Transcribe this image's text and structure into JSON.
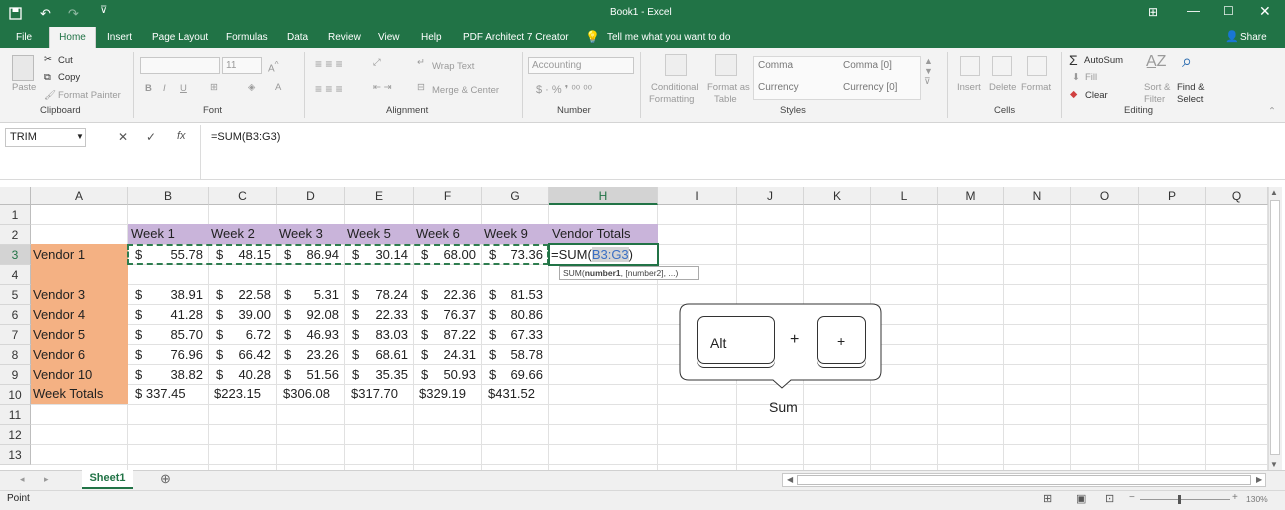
{
  "window": {
    "title": "Book1 - Excel"
  },
  "menu": {
    "tabs": [
      "File",
      "Home",
      "Insert",
      "Page Layout",
      "Formulas",
      "Data",
      "Review",
      "View",
      "Help",
      "PDF Architect 7 Creator"
    ],
    "tell_me": "Tell me what you want to do",
    "share": "Share"
  },
  "ribbon": {
    "clipboard": {
      "paste": "Paste",
      "cut": "Cut",
      "copy": "Copy",
      "format_painter": "Format Painter",
      "label": "Clipboard"
    },
    "font": {
      "size": "11",
      "label": "Font",
      "bold": "B",
      "italic": "I",
      "underline": "U"
    },
    "alignment": {
      "wrap": "Wrap Text",
      "merge": "Merge & Center",
      "label": "Alignment"
    },
    "number": {
      "format": "Accounting",
      "label": "Number"
    },
    "styles": {
      "conditional": "Conditional",
      "conditional2": "Formatting",
      "format_as": "Format as",
      "table": "Table",
      "comma": "Comma",
      "comma0": "Comma [0]",
      "currency": "Currency",
      "currency0": "Currency [0]",
      "label": "Styles"
    },
    "cells": {
      "insert": "Insert",
      "delete": "Delete",
      "format": "Format",
      "label": "Cells"
    },
    "editing": {
      "autosum": "AutoSum",
      "fill": "Fill",
      "clear": "Clear",
      "sort": "Sort &",
      "filter": "Filter",
      "find": "Find &",
      "select": "Select",
      "label": "Editing"
    }
  },
  "formula_bar": {
    "name_box": "TRIM",
    "fx": "fx",
    "formula": "=SUM(B3:G3)"
  },
  "columns": [
    "A",
    "B",
    "C",
    "D",
    "E",
    "F",
    "G",
    "H",
    "I",
    "J",
    "K",
    "L",
    "M",
    "N",
    "O",
    "P",
    "Q"
  ],
  "rows": [
    "1",
    "2",
    "3",
    "4",
    "5",
    "6",
    "7",
    "8",
    "9",
    "10",
    "11",
    "12",
    "13"
  ],
  "headers": [
    "Week 1",
    "Week 2",
    "Week 3",
    "Week 5",
    "Week 6",
    "Week 9",
    "Vendor Totals"
  ],
  "table_rows": [
    {
      "row": 3,
      "vendor": "Vendor 1",
      "values": [
        "55.78",
        "48.15",
        "86.94",
        "30.14",
        "68.00",
        "73.36"
      ]
    },
    {
      "row": 5,
      "vendor": "Vendor 3",
      "values": [
        "38.91",
        "22.58",
        "5.31",
        "78.24",
        "22.36",
        "81.53"
      ]
    },
    {
      "row": 6,
      "vendor": "Vendor 4",
      "values": [
        "41.28",
        "39.00",
        "92.08",
        "22.33",
        "76.37",
        "80.86"
      ]
    },
    {
      "row": 7,
      "vendor": "Vendor 5",
      "values": [
        "85.70",
        "6.72",
        "46.93",
        "83.03",
        "87.22",
        "67.33"
      ]
    },
    {
      "row": 8,
      "vendor": "Vendor 6",
      "values": [
        "76.96",
        "66.42",
        "23.26",
        "68.61",
        "24.31",
        "58.78"
      ]
    },
    {
      "row": 9,
      "vendor": "Vendor 10",
      "values": [
        "38.82",
        "40.28",
        "51.56",
        "35.35",
        "50.93",
        "69.66"
      ]
    }
  ],
  "totals": {
    "label": "Week Totals",
    "values": [
      "$ 337.45",
      "$223.15",
      "$306.08",
      "$317.70",
      "$329.19",
      "$431.52"
    ]
  },
  "currency_symbol": "$",
  "active_cell": {
    "prefix": "=SUM(",
    "ref": "B3:G3",
    "suffix": ")"
  },
  "tooltip": {
    "fn": "SUM(",
    "arg1": "number1",
    "rest": ", [number2], ...)"
  },
  "callout": {
    "key1": "Alt",
    "plus": "+",
    "key2": "+",
    "caption": "Sum"
  },
  "sheet": {
    "tab": "Sheet1"
  },
  "status": {
    "mode": "Point",
    "zoom": "130%"
  },
  "colors": {
    "excel_green": "#217346",
    "header_purple": "#c9b4da",
    "vendor_orange": "#f4b183",
    "ref_blue": "#3a6fc4"
  }
}
